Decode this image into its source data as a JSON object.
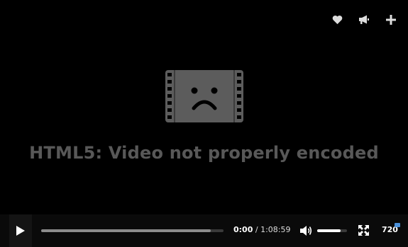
{
  "top_actions": {
    "icons": [
      "heart-icon",
      "megaphone-icon",
      "plus-icon"
    ]
  },
  "error": {
    "icon": "sad-film-icon",
    "message": "HTML5: Video not properly encoded"
  },
  "controls": {
    "play_icon": "play-icon",
    "progress_buffered_fraction": 0.93,
    "current_time": "0:00",
    "separator": " / ",
    "duration": "1:08:59",
    "volume_icon": "volume-icon",
    "volume_fraction": 0.78,
    "fullscreen_icon": "fullscreen-icon",
    "quality": "720",
    "hd_badge_color": "#4a90d9"
  },
  "colors": {
    "background": "#000000",
    "error_text": "#585858",
    "icon_gray": "#5c5c5c"
  }
}
